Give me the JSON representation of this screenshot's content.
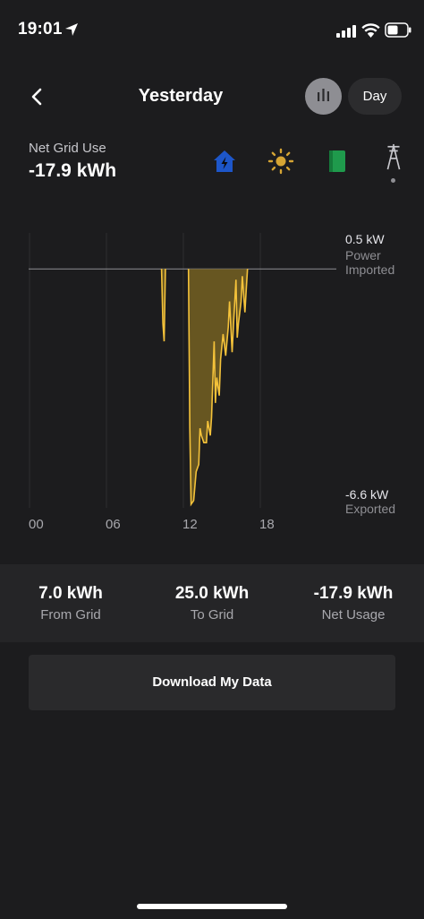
{
  "status_bar": {
    "time": "19:01"
  },
  "header": {
    "title": "Yesterday",
    "period": "Day"
  },
  "metric": {
    "label": "Net Grid Use",
    "value": "-17.9 kWh"
  },
  "icons": {
    "home": "home-icon",
    "solar": "sun-icon",
    "battery": "powerwall-icon",
    "grid": "grid-tower-icon"
  },
  "colors": {
    "accent": "#f4c23a",
    "home": "#1d56c9",
    "solar": "#d6a534",
    "battery": "#1f9a4c",
    "background": "#1c1c1e"
  },
  "chart_data": {
    "type": "area",
    "x_ticks": [
      "00",
      "06",
      "12",
      "18"
    ],
    "y_top_value": "0.5 kW",
    "y_top_label": "Power Imported",
    "y_top_label_lines": [
      "Power",
      "Imported"
    ],
    "y_bottom_value": "-6.6 kW",
    "y_bottom_label": "Exported",
    "ylim": [
      -6.6,
      0.5
    ],
    "xlim": [
      0,
      24
    ],
    "x": [
      10.3,
      10.4,
      10.5,
      10.6,
      12.4,
      12.5,
      12.6,
      12.8,
      12.9,
      13.0,
      13.2,
      13.3,
      13.4,
      13.6,
      13.8,
      13.9,
      14.1,
      14.2,
      14.4,
      14.5,
      14.6,
      14.8,
      14.9,
      15.1,
      15.2,
      15.3,
      15.5,
      15.6,
      15.8,
      15.9,
      16.1,
      16.2,
      16.3,
      16.5,
      16.6,
      16.8,
      16.9,
      17.0
    ],
    "y": [
      0,
      -1.5,
      -2.0,
      0,
      0,
      -4.4,
      -6.5,
      -6.4,
      -6.0,
      -5.6,
      -5.4,
      -4.4,
      -4.6,
      -4.8,
      -4.8,
      -4.2,
      -4.6,
      -4.1,
      -2.0,
      -3.7,
      -3.0,
      -3.5,
      -2.5,
      -1.8,
      -2.1,
      -2.4,
      -1.6,
      -0.9,
      -2.3,
      -1.6,
      -0.3,
      -1.9,
      -1.5,
      -0.9,
      -0.2,
      -1.2,
      -0.6,
      0
    ]
  },
  "summary": [
    {
      "value": "7.0 kWh",
      "label": "From Grid"
    },
    {
      "value": "25.0 kWh",
      "label": "To Grid"
    },
    {
      "value": "-17.9 kWh",
      "label": "Net Usage"
    }
  ],
  "download_label": "Download My Data"
}
